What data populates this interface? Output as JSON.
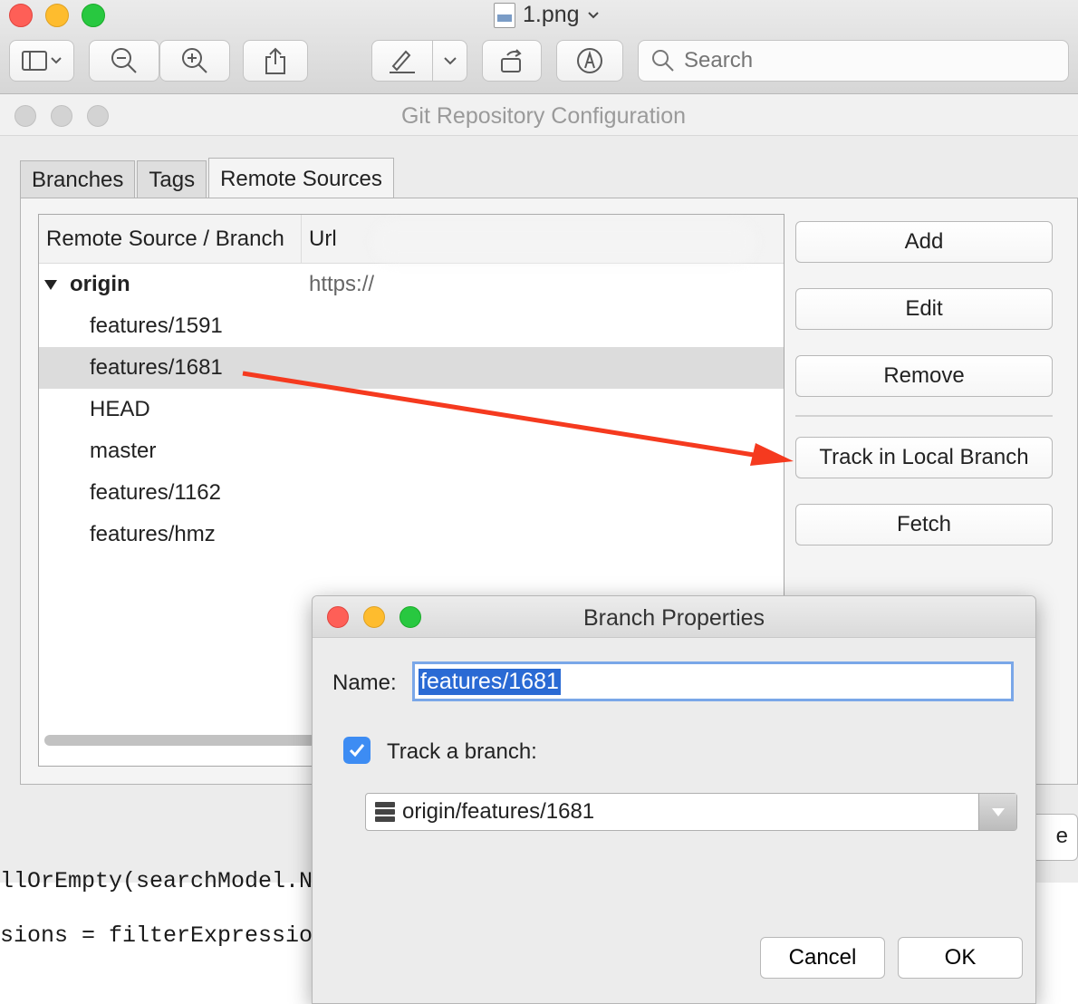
{
  "preview": {
    "file_title": "1.png",
    "search_placeholder": "Search",
    "colors": {
      "close": "#fe5f57",
      "minimize": "#febc2e",
      "zoom": "#28c840"
    }
  },
  "git_window": {
    "title": "Git Repository Configuration",
    "tabs": [
      {
        "label": "Branches",
        "active": false
      },
      {
        "label": "Tags",
        "active": false
      },
      {
        "label": "Remote Sources",
        "active": true
      }
    ],
    "columns": {
      "source": "Remote Source / Branch",
      "url": "Url"
    },
    "remote": {
      "name": "origin",
      "url": "https://"
    },
    "branches": [
      "features/1591",
      "features/1681",
      "HEAD",
      "master",
      "features/1162",
      "features/hmz"
    ],
    "selected_branch": "features/1681",
    "buttons": {
      "add": "Add",
      "edit": "Edit",
      "remove": "Remove",
      "track": "Track in Local Branch",
      "fetch": "Fetch"
    },
    "behind_button_fragment": "e"
  },
  "background_code": {
    "line1": "llOrEmpty(searchModel.Nam",
    "line2": "sions = filterExpressions"
  },
  "dialog": {
    "title": "Branch Properties",
    "name_label": "Name:",
    "name_value": "features/1681",
    "track_checked": true,
    "track_label": "Track a branch:",
    "tracked_branch": "origin/features/1681",
    "cancel": "Cancel",
    "ok": "OK"
  },
  "annotation": {
    "arrow_color": "#f53a1f"
  }
}
